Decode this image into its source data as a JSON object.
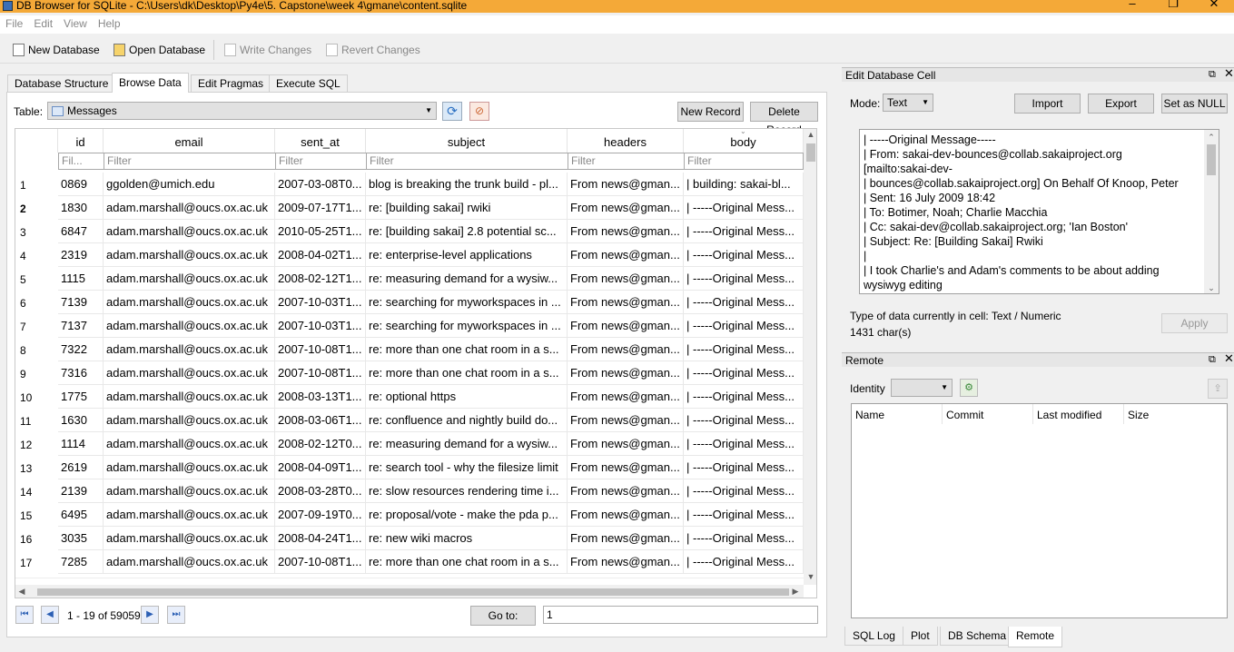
{
  "window": {
    "title": "DB Browser for SQLite - C:\\Users\\dk\\Desktop\\Py4e\\5. Capstone\\week 4\\gmane\\content.sqlite"
  },
  "menu": [
    "File",
    "Edit",
    "View",
    "Help"
  ],
  "toolbar": {
    "new_db": "New Database",
    "open_db": "Open Database",
    "write": "Write Changes",
    "revert": "Revert Changes"
  },
  "tabs": [
    "Database Structure",
    "Browse Data",
    "Edit Pragmas",
    "Execute SQL"
  ],
  "browse": {
    "table_label": "Table:",
    "table_value": "Messages",
    "new_record": "New Record",
    "delete_record": "Delete Record",
    "filter_placeholder": "Filter",
    "id_filter": "Fil...",
    "columns": [
      "id",
      "email",
      "sent_at",
      "subject",
      "headers",
      "body"
    ],
    "rows": [
      [
        "1",
        "0869",
        "ggolden@umich.edu",
        "2007-03-08T0...",
        "blog is breaking the trunk build - pl...",
        "From news@gman...",
        "| building: sakai-bl..."
      ],
      [
        "2",
        "1830",
        "adam.marshall@oucs.ox.ac.uk",
        "2009-07-17T1...",
        "re: [building sakai] rwiki",
        "From news@gman...",
        "| -----Original Mess..."
      ],
      [
        "3",
        "6847",
        "adam.marshall@oucs.ox.ac.uk",
        "2010-05-25T1...",
        "re: [building sakai] 2.8 potential sc...",
        "From news@gman...",
        "| -----Original Mess..."
      ],
      [
        "4",
        "2319",
        "adam.marshall@oucs.ox.ac.uk",
        "2008-04-02T1...",
        "re: enterprise-level applications",
        "From news@gman...",
        "| -----Original Mess..."
      ],
      [
        "5",
        "1115",
        "adam.marshall@oucs.ox.ac.uk",
        "2008-02-12T1...",
        "re: measuring demand for a wysiw...",
        "From news@gman...",
        "| -----Original Mess..."
      ],
      [
        "6",
        "7139",
        "adam.marshall@oucs.ox.ac.uk",
        "2007-10-03T1...",
        "re: searching for myworkspaces in ...",
        "From news@gman...",
        "| -----Original Mess..."
      ],
      [
        "7",
        "7137",
        "adam.marshall@oucs.ox.ac.uk",
        "2007-10-03T1...",
        "re: searching for myworkspaces in ...",
        "From news@gman...",
        "| -----Original Mess..."
      ],
      [
        "8",
        "7322",
        "adam.marshall@oucs.ox.ac.uk",
        "2007-10-08T1...",
        "re: more than one chat room in a s...",
        "From news@gman...",
        "| -----Original Mess..."
      ],
      [
        "9",
        "7316",
        "adam.marshall@oucs.ox.ac.uk",
        "2007-10-08T1...",
        "re: more than one chat room in a s...",
        "From news@gman...",
        "| -----Original Mess..."
      ],
      [
        "10",
        "1775",
        "adam.marshall@oucs.ox.ac.uk",
        "2008-03-13T1...",
        "re: optional https",
        "From news@gman...",
        "| -----Original Mess..."
      ],
      [
        "11",
        "1630",
        "adam.marshall@oucs.ox.ac.uk",
        "2008-03-06T1...",
        "re: confluence and nightly build do...",
        "From news@gman...",
        "| -----Original Mess..."
      ],
      [
        "12",
        "1114",
        "adam.marshall@oucs.ox.ac.uk",
        "2008-02-12T0...",
        "re: measuring demand for a wysiw...",
        "From news@gman...",
        "| -----Original Mess..."
      ],
      [
        "13",
        "2619",
        "adam.marshall@oucs.ox.ac.uk",
        "2008-04-09T1...",
        "re: search tool - why the filesize limit",
        "From news@gman...",
        "| -----Original Mess..."
      ],
      [
        "14",
        "2139",
        "adam.marshall@oucs.ox.ac.uk",
        "2008-03-28T0...",
        "re: slow resources rendering time i...",
        "From news@gman...",
        "| -----Original Mess..."
      ],
      [
        "15",
        "6495",
        "adam.marshall@oucs.ox.ac.uk",
        "2007-09-19T0...",
        "re: proposal/vote - make the pda p...",
        "From news@gman...",
        "| -----Original Mess..."
      ],
      [
        "16",
        "3035",
        "adam.marshall@oucs.ox.ac.uk",
        "2008-04-24T1...",
        "re: new wiki macros",
        "From news@gman...",
        "| -----Original Mess..."
      ],
      [
        "17",
        "7285",
        "adam.marshall@oucs.ox.ac.uk",
        "2007-10-08T1...",
        "re: more than one chat room in a s...",
        "From news@gman...",
        "| -----Original Mess..."
      ]
    ],
    "record_count": "1 - 19 of 59059",
    "goto_label": "Go to:",
    "goto_value": "1"
  },
  "edit_cell": {
    "title": "Edit Database Cell",
    "mode_label": "Mode:",
    "mode_value": "Text",
    "import": "Import",
    "export": "Export",
    "set_null": "Set as NULL",
    "text_lines": [
      "| -----Original Message-----",
      "| From: sakai-dev-bounces@collab.sakaiproject.org",
      "[mailto:sakai-dev-",
      "| bounces@collab.sakaiproject.org] On Behalf Of Knoop, Peter",
      "| Sent: 16 July 2009 18:42",
      "| To: Botimer, Noah; Charlie Macchia",
      "| Cc: sakai-dev@collab.sakaiproject.org; 'Ian Boston'",
      "| Subject: Re: [Building Sakai] Rwiki",
      "|",
      "| I took Charlie's and Adam's comments to be about adding",
      "wysiwyg editing"
    ],
    "type_info": "Type of data currently in cell: Text / Numeric",
    "char_count": "1431 char(s)",
    "apply": "Apply"
  },
  "remote": {
    "title": "Remote",
    "identity_label": "Identity",
    "columns": [
      "Name",
      "Commit",
      "Last modified",
      "Size"
    ]
  },
  "bottom_tabs": [
    "SQL Log",
    "Plot",
    "DB Schema",
    "Remote"
  ]
}
